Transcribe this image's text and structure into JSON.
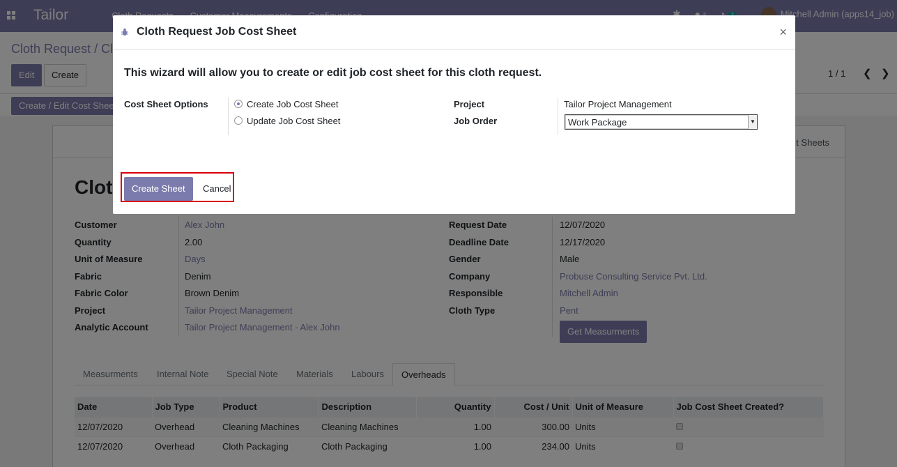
{
  "navbar": {
    "app_name": "Tailor",
    "menus": [
      "Cloth Requests",
      "Customer Measurements",
      "Configuration"
    ],
    "chat_count": "5",
    "activity_count": "7",
    "user": "Mitchell Admin (apps14_job)"
  },
  "control_panel": {
    "breadcrumb": "Cloth Request / Cl",
    "edit_label": "Edit",
    "create_label": "Create",
    "pager": "1 / 1",
    "cost_sheet_button": "Create / Edit Cost Sheet"
  },
  "form": {
    "stat_button": "t Sheets",
    "title": "Cloth",
    "left_fields": [
      {
        "label": "Customer",
        "value": "Alex John",
        "link": true
      },
      {
        "label": "Quantity",
        "value": "2.00",
        "link": false
      },
      {
        "label": "Unit of Measure",
        "value": "Days",
        "link": true
      },
      {
        "label": "Fabric",
        "value": "Denim",
        "link": false
      },
      {
        "label": "Fabric Color",
        "value": "Brown Denim",
        "link": false
      },
      {
        "label": "Project",
        "value": "Tailor Project Management",
        "link": true
      },
      {
        "label": "Analytic Account",
        "value": "Tailor Project Management - Alex John",
        "link": true
      }
    ],
    "right_fields": [
      {
        "label": "Request Date",
        "value": "12/07/2020",
        "link": false
      },
      {
        "label": "Deadline Date",
        "value": "12/17/2020",
        "link": false
      },
      {
        "label": "Gender",
        "value": "Male",
        "link": false
      },
      {
        "label": "Company",
        "value": "Probuse Consulting Service Pvt. Ltd.",
        "link": true
      },
      {
        "label": "Responsible",
        "value": "Mitchell Admin",
        "link": true
      },
      {
        "label": "Cloth Type",
        "value": "Pent",
        "link": true
      }
    ],
    "measure_button": "Get Measurments",
    "tabs": [
      "Measurments",
      "Internal Note",
      "Special Note",
      "Materials",
      "Labours",
      "Overheads"
    ],
    "active_tab": "Overheads",
    "table": {
      "headers": [
        "Date",
        "Job Type",
        "Product",
        "Description",
        "Quantity",
        "Cost / Unit",
        "Unit of Measure",
        "Job Cost Sheet Created?"
      ],
      "rows": [
        [
          "12/07/2020",
          "Overhead",
          "Cleaning Machines",
          "Cleaning Machines",
          "1.00",
          "300.00",
          "Units",
          true
        ],
        [
          "12/07/2020",
          "Overhead",
          "Cloth Packaging",
          "Cloth Packaging",
          "1.00",
          "234.00",
          "Units",
          true
        ]
      ]
    }
  },
  "modal": {
    "title": "Cloth Request Job Cost Sheet",
    "close": "×",
    "wizard_text": "This wizard will allow you to create or edit job cost sheet for this cloth request.",
    "options_label": "Cost Sheet Options",
    "option_create": "Create Job Cost Sheet",
    "option_update": "Update Job Cost Sheet",
    "selected_option": "create",
    "project_label": "Project",
    "project_value": "Tailor Project Management",
    "job_order_label": "Job Order",
    "job_order_value": "Work Package",
    "create_sheet": "Create Sheet",
    "cancel": "Cancel"
  },
  "colors": {
    "accent": "#7c7bad",
    "highlight": "#d9000a"
  }
}
